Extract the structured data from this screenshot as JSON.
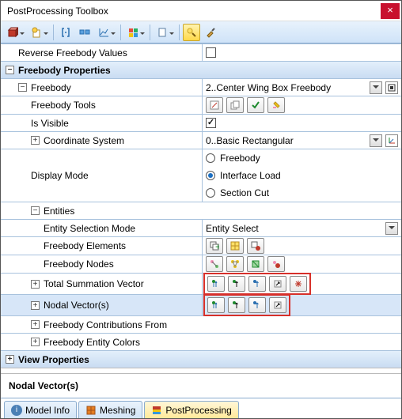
{
  "window": {
    "title": "PostProcessing Toolbox"
  },
  "rows": {
    "reverse": "Reverse Freebody Values",
    "fbprops": "Freebody Properties",
    "freebody": "Freebody",
    "freebody_val": "2..Center Wing Box Freebody",
    "fbtools": "Freebody Tools",
    "visible": "Is Visible",
    "csys": "Coordinate System",
    "csys_val": "0..Basic Rectangular",
    "dmode": "Display Mode",
    "dmode_opts": [
      "Freebody",
      "Interface Load",
      "Section Cut"
    ],
    "entities": "Entities",
    "selmode": "Entity Selection Mode",
    "selmode_val": "Entity Select",
    "fbelem": "Freebody Elements",
    "fbnode": "Freebody Nodes",
    "tsv": "Total Summation Vector",
    "nvec": "Nodal Vector(s)",
    "fbcontrib": "Freebody Contributions From",
    "fbcolors": "Freebody Entity Colors",
    "viewprops": "View Properties"
  },
  "detail_label": "Nodal Vector(s)",
  "tabs": {
    "model": "Model Info",
    "mesh": "Meshing",
    "pp": "PostProcessing"
  }
}
